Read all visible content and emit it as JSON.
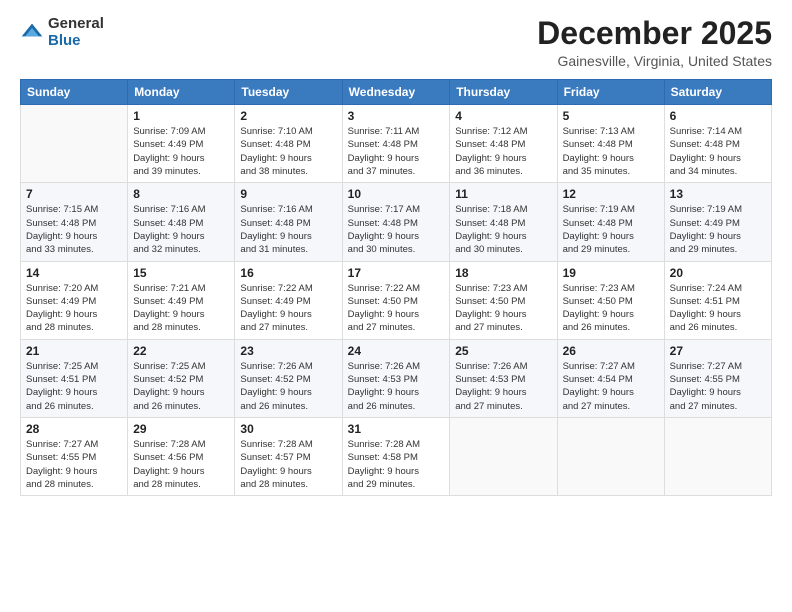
{
  "logo": {
    "general": "General",
    "blue": "Blue"
  },
  "title": "December 2025",
  "subtitle": "Gainesville, Virginia, United States",
  "header_days": [
    "Sunday",
    "Monday",
    "Tuesday",
    "Wednesday",
    "Thursday",
    "Friday",
    "Saturday"
  ],
  "weeks": [
    [
      {
        "day": "",
        "info": ""
      },
      {
        "day": "1",
        "info": "Sunrise: 7:09 AM\nSunset: 4:49 PM\nDaylight: 9 hours\nand 39 minutes."
      },
      {
        "day": "2",
        "info": "Sunrise: 7:10 AM\nSunset: 4:48 PM\nDaylight: 9 hours\nand 38 minutes."
      },
      {
        "day": "3",
        "info": "Sunrise: 7:11 AM\nSunset: 4:48 PM\nDaylight: 9 hours\nand 37 minutes."
      },
      {
        "day": "4",
        "info": "Sunrise: 7:12 AM\nSunset: 4:48 PM\nDaylight: 9 hours\nand 36 minutes."
      },
      {
        "day": "5",
        "info": "Sunrise: 7:13 AM\nSunset: 4:48 PM\nDaylight: 9 hours\nand 35 minutes."
      },
      {
        "day": "6",
        "info": "Sunrise: 7:14 AM\nSunset: 4:48 PM\nDaylight: 9 hours\nand 34 minutes."
      }
    ],
    [
      {
        "day": "7",
        "info": "Sunrise: 7:15 AM\nSunset: 4:48 PM\nDaylight: 9 hours\nand 33 minutes."
      },
      {
        "day": "8",
        "info": "Sunrise: 7:16 AM\nSunset: 4:48 PM\nDaylight: 9 hours\nand 32 minutes."
      },
      {
        "day": "9",
        "info": "Sunrise: 7:16 AM\nSunset: 4:48 PM\nDaylight: 9 hours\nand 31 minutes."
      },
      {
        "day": "10",
        "info": "Sunrise: 7:17 AM\nSunset: 4:48 PM\nDaylight: 9 hours\nand 30 minutes."
      },
      {
        "day": "11",
        "info": "Sunrise: 7:18 AM\nSunset: 4:48 PM\nDaylight: 9 hours\nand 30 minutes."
      },
      {
        "day": "12",
        "info": "Sunrise: 7:19 AM\nSunset: 4:48 PM\nDaylight: 9 hours\nand 29 minutes."
      },
      {
        "day": "13",
        "info": "Sunrise: 7:19 AM\nSunset: 4:49 PM\nDaylight: 9 hours\nand 29 minutes."
      }
    ],
    [
      {
        "day": "14",
        "info": "Sunrise: 7:20 AM\nSunset: 4:49 PM\nDaylight: 9 hours\nand 28 minutes."
      },
      {
        "day": "15",
        "info": "Sunrise: 7:21 AM\nSunset: 4:49 PM\nDaylight: 9 hours\nand 28 minutes."
      },
      {
        "day": "16",
        "info": "Sunrise: 7:22 AM\nSunset: 4:49 PM\nDaylight: 9 hours\nand 27 minutes."
      },
      {
        "day": "17",
        "info": "Sunrise: 7:22 AM\nSunset: 4:50 PM\nDaylight: 9 hours\nand 27 minutes."
      },
      {
        "day": "18",
        "info": "Sunrise: 7:23 AM\nSunset: 4:50 PM\nDaylight: 9 hours\nand 27 minutes."
      },
      {
        "day": "19",
        "info": "Sunrise: 7:23 AM\nSunset: 4:50 PM\nDaylight: 9 hours\nand 26 minutes."
      },
      {
        "day": "20",
        "info": "Sunrise: 7:24 AM\nSunset: 4:51 PM\nDaylight: 9 hours\nand 26 minutes."
      }
    ],
    [
      {
        "day": "21",
        "info": "Sunrise: 7:25 AM\nSunset: 4:51 PM\nDaylight: 9 hours\nand 26 minutes."
      },
      {
        "day": "22",
        "info": "Sunrise: 7:25 AM\nSunset: 4:52 PM\nDaylight: 9 hours\nand 26 minutes."
      },
      {
        "day": "23",
        "info": "Sunrise: 7:26 AM\nSunset: 4:52 PM\nDaylight: 9 hours\nand 26 minutes."
      },
      {
        "day": "24",
        "info": "Sunrise: 7:26 AM\nSunset: 4:53 PM\nDaylight: 9 hours\nand 26 minutes."
      },
      {
        "day": "25",
        "info": "Sunrise: 7:26 AM\nSunset: 4:53 PM\nDaylight: 9 hours\nand 27 minutes."
      },
      {
        "day": "26",
        "info": "Sunrise: 7:27 AM\nSunset: 4:54 PM\nDaylight: 9 hours\nand 27 minutes."
      },
      {
        "day": "27",
        "info": "Sunrise: 7:27 AM\nSunset: 4:55 PM\nDaylight: 9 hours\nand 27 minutes."
      }
    ],
    [
      {
        "day": "28",
        "info": "Sunrise: 7:27 AM\nSunset: 4:55 PM\nDaylight: 9 hours\nand 28 minutes."
      },
      {
        "day": "29",
        "info": "Sunrise: 7:28 AM\nSunset: 4:56 PM\nDaylight: 9 hours\nand 28 minutes."
      },
      {
        "day": "30",
        "info": "Sunrise: 7:28 AM\nSunset: 4:57 PM\nDaylight: 9 hours\nand 28 minutes."
      },
      {
        "day": "31",
        "info": "Sunrise: 7:28 AM\nSunset: 4:58 PM\nDaylight: 9 hours\nand 29 minutes."
      },
      {
        "day": "",
        "info": ""
      },
      {
        "day": "",
        "info": ""
      },
      {
        "day": "",
        "info": ""
      }
    ]
  ]
}
